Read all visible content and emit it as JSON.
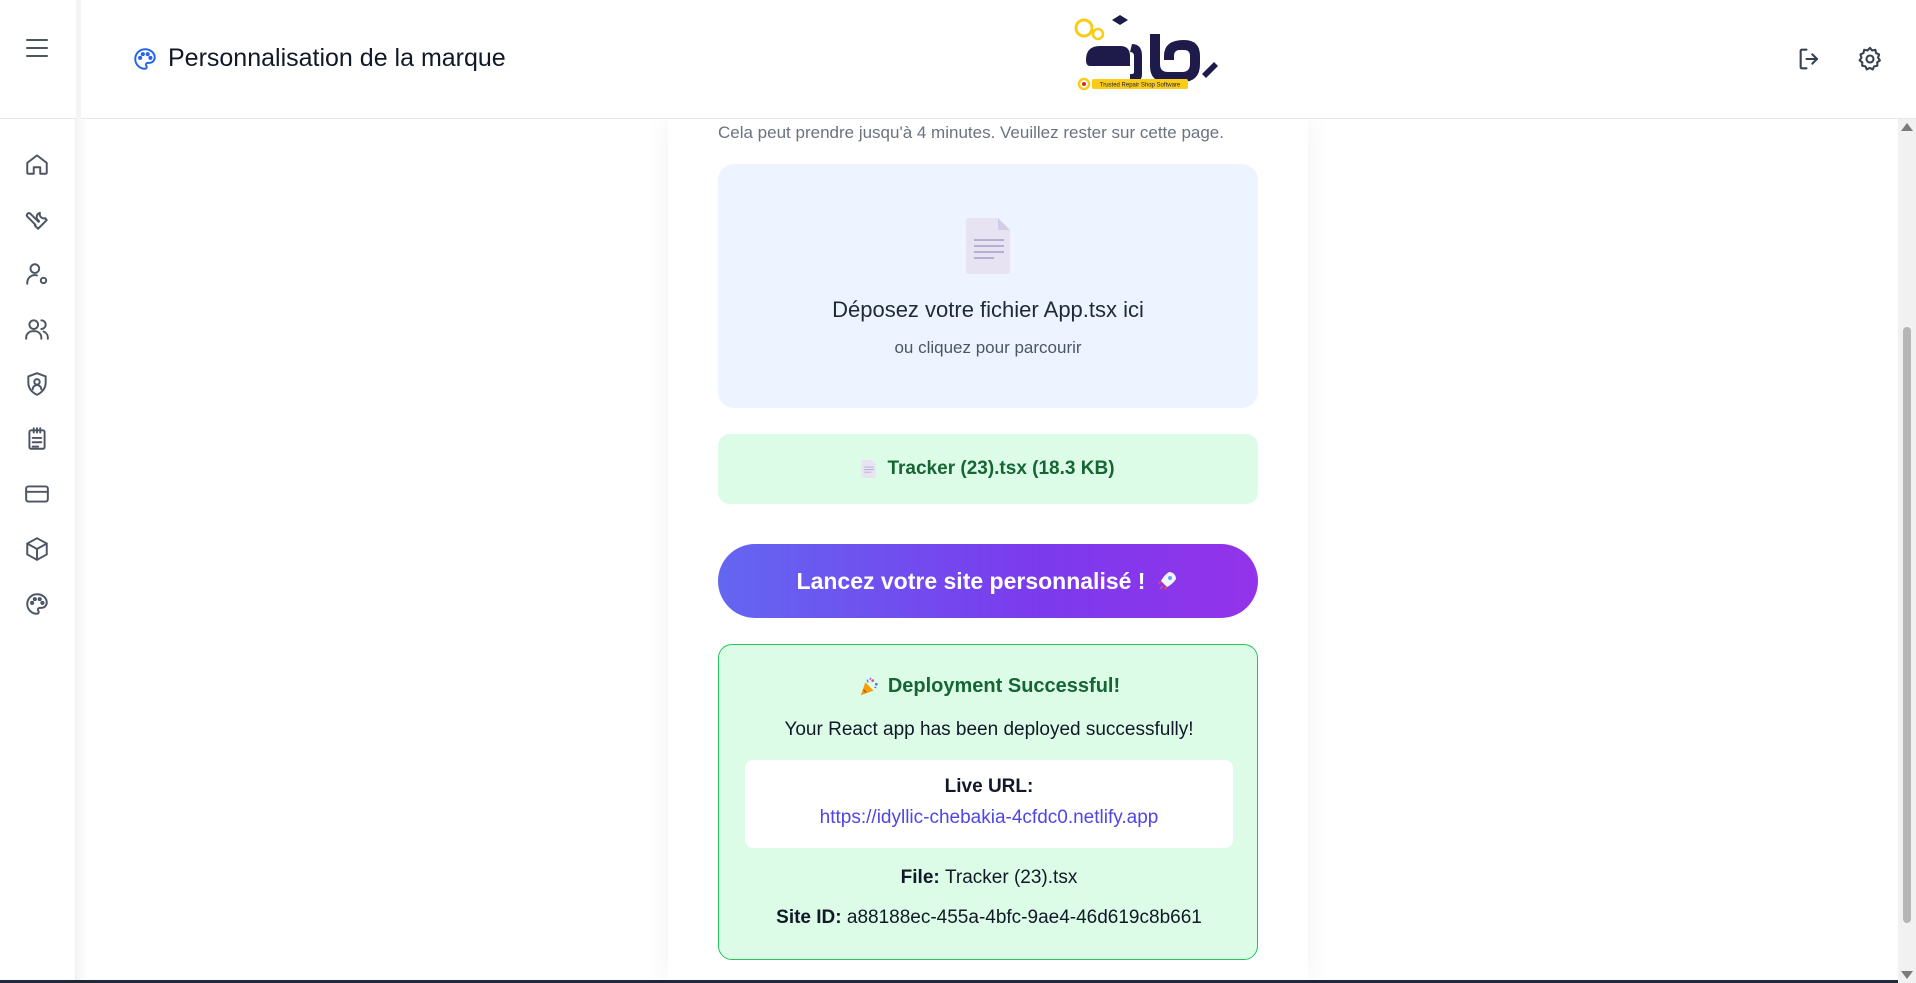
{
  "header": {
    "title": "Personnalisation de la marque",
    "logo_tagline": "Trusted Repair Shop Software"
  },
  "sidebar": {
    "items": [
      {
        "icon": "home-icon"
      },
      {
        "icon": "wrench-icon"
      },
      {
        "icon": "user-gear-icon"
      },
      {
        "icon": "users-icon"
      },
      {
        "icon": "shield-user-icon"
      },
      {
        "icon": "clipboard-icon"
      },
      {
        "icon": "credit-card-icon"
      },
      {
        "icon": "box-icon"
      },
      {
        "icon": "palette-icon"
      }
    ]
  },
  "main": {
    "note": "Cela peut prendre jusqu'à 4 minutes. Veuillez rester sur cette page.",
    "dropzone": {
      "title": "Déposez votre fichier App.tsx ici",
      "subtitle": "ou cliquez pour parcourir"
    },
    "selected_file": "Tracker (23).tsx (18.3 KB)",
    "launch_button": "Lancez votre site personnalisé !",
    "success": {
      "title": "Deployment Successful!",
      "message": "Your React app has been deployed successfully!",
      "live_url_label": "Live URL:",
      "live_url": "https://idyllic-chebakia-4cfdc0.netlify.app",
      "file_label": "File:",
      "file_value": "Tracker (23).tsx",
      "site_id_label": "Site ID:",
      "site_id_value": "a88188ec-455a-4bfc-9ae4-46d619c8b661"
    }
  },
  "colors": {
    "accent": "#2563eb",
    "success_bg": "#dcfce7",
    "success_border": "#22c55e",
    "button_start": "#6366f1",
    "button_end": "#9333ea",
    "link": "#4f46e5"
  }
}
